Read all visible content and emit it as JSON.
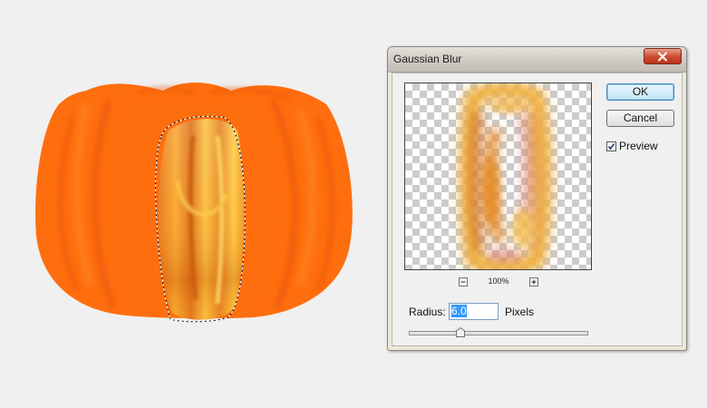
{
  "canvas": {
    "colors": {
      "pumpkin": "#ff6e0e",
      "pumpkin_shade": "#f25f06",
      "segment_light": "#ffc43a",
      "segment_dark": "#e4741a"
    }
  },
  "dialog": {
    "title": "Gaussian Blur",
    "ok_label": "OK",
    "cancel_label": "Cancel",
    "preview_checkbox": {
      "label": "Preview",
      "checked": true
    },
    "zoom": {
      "level": "100%"
    },
    "radius": {
      "label": "Radius:",
      "value": "6.0",
      "unit": "Pixels",
      "slider_fraction": 0.29
    },
    "icons": {
      "close": "close-icon",
      "zoom_out": "zoom-out-icon",
      "zoom_in": "zoom-in-icon",
      "check": "check-icon"
    }
  }
}
